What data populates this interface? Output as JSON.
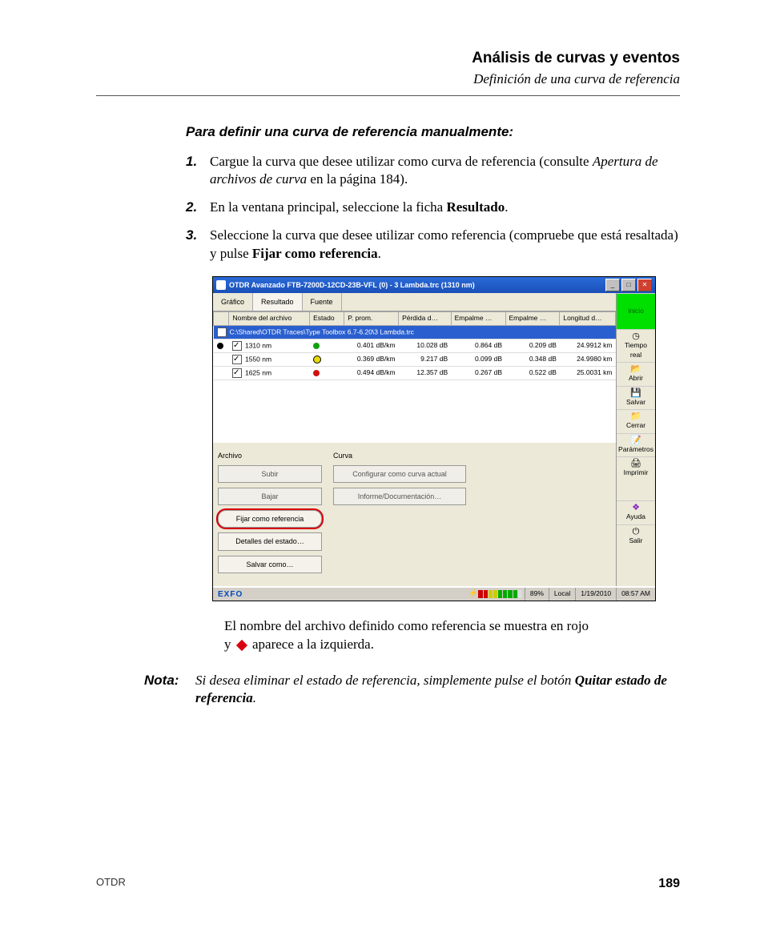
{
  "header": {
    "title": "Análisis de curvas y eventos",
    "subtitle": "Definición de una curva de referencia"
  },
  "proc_heading": "Para definir una curva de referencia manualmente:",
  "steps": [
    {
      "num": "1.",
      "html": "Cargue la curva que desee utilizar como curva de referencia (consulte <em>Apertura de archivos de curva</em> en la página 184)."
    },
    {
      "num": "2.",
      "html": "En la ventana principal, seleccione la ficha <strong>Resultado</strong>."
    },
    {
      "num": "3.",
      "html": "Seleccione la curva que desee utilizar como referencia (compruebe que está resaltada) y pulse <strong>Fijar como referencia</strong>."
    }
  ],
  "screenshot": {
    "title": "OTDR Avanzado FTB-7200D-12CD-23B-VFL (0) - 3 Lambda.trc (1310 nm)",
    "tabs": [
      "Gráfico",
      "Resultado",
      "Fuente"
    ],
    "columns": [
      "",
      "Nombre del archivo",
      "Estado",
      "P. prom.",
      "Pérdida d…",
      "Empalme …",
      "Empalme …",
      "Longitud d…"
    ],
    "path": "C:\\Shared\\OTDR Traces\\Type Toolbox 6.7-6.20\\3 Lambda.trc",
    "rows": [
      {
        "mark": "black",
        "name": "1310 nm",
        "state": "green",
        "pprom": "0.401 dB/km",
        "perdida": "10.028 dB",
        "emp1": "0.864 dB",
        "emp2": "0.209 dB",
        "long": "24.9912 km"
      },
      {
        "mark": "",
        "name": "1550 nm",
        "state": "yellow",
        "pprom": "0.369 dB/km",
        "perdida": "9.217 dB",
        "emp1": "0.099 dB",
        "emp2": "0.348 dB",
        "long": "24.9980 km"
      },
      {
        "mark": "",
        "name": "1625 nm",
        "state": "red",
        "pprom": "0.494 dB/km",
        "perdida": "12.357 dB",
        "emp1": "0.267 dB",
        "emp2": "0.522 dB",
        "long": "25.0031 km"
      }
    ],
    "group_archivo": {
      "title": "Archivo",
      "buttons": [
        "Subir",
        "Bajar",
        "Fijar como referencia",
        "Detalles del estado…",
        "Salvar como…"
      ]
    },
    "group_curva": {
      "title": "Curva",
      "buttons": [
        "Configurar como curva actual",
        "Informe/Documentación…"
      ]
    },
    "side": [
      "Inicio",
      "Tiempo real",
      "Abrir",
      "Salvar",
      "Cerrar",
      "Parámetros",
      "Imprimir",
      "Ayuda",
      "Salir"
    ],
    "status": {
      "brand": "EXFO",
      "percent": "89%",
      "loc": "Local",
      "date": "1/19/2010",
      "time": "08:57 AM"
    }
  },
  "after_ss": {
    "line1": "El nombre del archivo definido como referencia se muestra en rojo",
    "line2_prefix": "y ",
    "line2_suffix": " aparece a la izquierda."
  },
  "note": {
    "label": "Nota:",
    "body_html": "Si desea eliminar el estado de referencia, simplemente pulse el botón <strong>Quitar estado de referencia</strong>."
  },
  "footer": {
    "left": "OTDR",
    "right": "189"
  }
}
